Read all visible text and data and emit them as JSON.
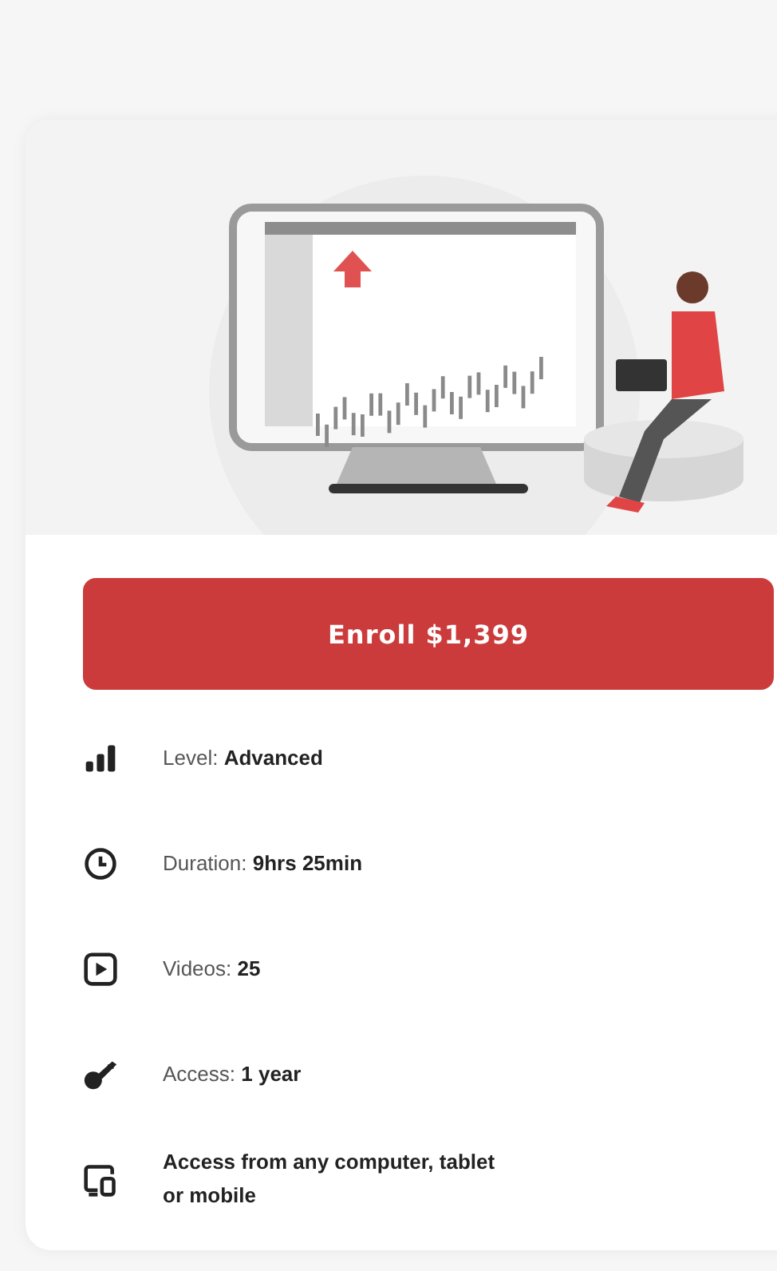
{
  "enroll_button": {
    "label": "Enroll $1,399"
  },
  "features": [
    {
      "kind": "level",
      "text": "Level: **Advanced**",
      "bold": false
    },
    {
      "kind": "duration",
      "text": "Duration: **9hrs 25min**",
      "bold": false
    },
    {
      "kind": "videos",
      "text": "Videos: **25**",
      "bold": false
    },
    {
      "kind": "access",
      "text": "Access: **1 year**",
      "bold": false
    },
    {
      "kind": "devices",
      "text": "Access from any computer, tablet or mobile",
      "bold": true
    }
  ]
}
